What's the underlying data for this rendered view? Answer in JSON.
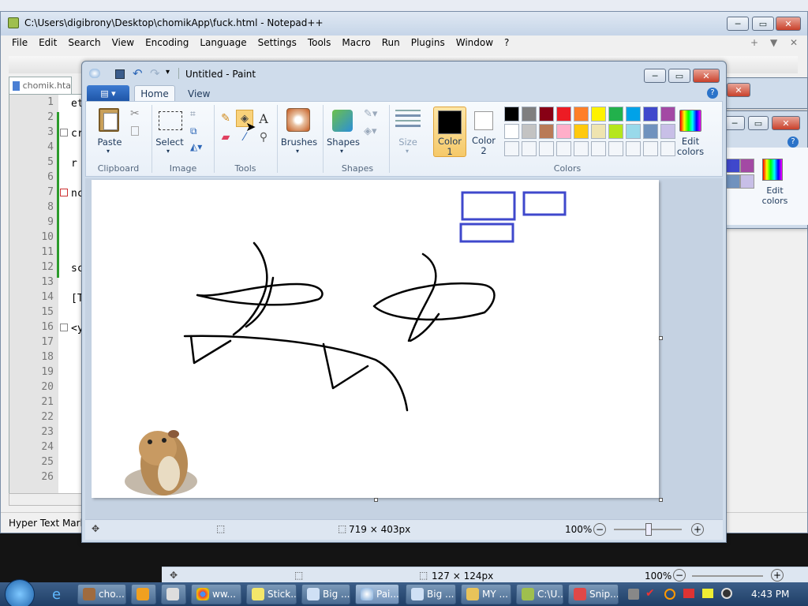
{
  "desktop": {
    "bg": "#101010"
  },
  "notepad": {
    "title": "C:\\Users\\digibrony\\Desktop\\chomikApp\\fuck.html - Notepad++",
    "menu": [
      "File",
      "Edit",
      "Search",
      "View",
      "Encoding",
      "Language",
      "Settings",
      "Tools",
      "Macro",
      "Run",
      "Plugins",
      "Window",
      "?"
    ],
    "tab_label": "chomik.hta",
    "line_numbers": [
      "1",
      "2",
      "3",
      "4",
      "5",
      "6",
      "7",
      "8",
      "9",
      "10",
      "11",
      "12",
      "13",
      "14",
      "15",
      "16",
      "17",
      "18",
      "19",
      "20",
      "21",
      "22",
      "23",
      "24",
      "25",
      "26"
    ],
    "code_fragments": [
      "et",
      "cr",
      "r",
      "nc",
      "sc",
      "[T",
      "<y"
    ],
    "status_left": "Hyper Text Marku",
    "menu_extra": [
      "+",
      "▼",
      "✕"
    ]
  },
  "back_paint": {
    "edit_colors": "Edit colors",
    "status_size": "127 × 124px",
    "zoom": "100%"
  },
  "paint": {
    "title": "Untitled - Paint",
    "tabs": {
      "home": "Home",
      "view": "View"
    },
    "groups": {
      "clipboard": "Clipboard",
      "image": "Image",
      "tools": "Tools",
      "shapes": "Shapes",
      "colors": "Colors"
    },
    "buttons": {
      "paste": "Paste",
      "select": "Select",
      "brushes": "Brushes",
      "shapes": "Shapes",
      "size": "Size",
      "color1": "Color",
      "color1_num": "1",
      "color2": "Color",
      "color2_num": "2",
      "edit_colors": "Edit colors"
    },
    "palette_row1": [
      "#000000",
      "#7f7f7f",
      "#880015",
      "#ed1c24",
      "#ff7f27",
      "#fff200",
      "#22b14c",
      "#00a2e8",
      "#3f48cc",
      "#a349a4"
    ],
    "palette_row2": [
      "#ffffff",
      "#c3c3c3",
      "#b97a57",
      "#ffaec9",
      "#ffc90e",
      "#efe4b0",
      "#b5e61d",
      "#99d9ea",
      "#7092be",
      "#c8bfe7"
    ],
    "color1_value": "#000000",
    "color2_value": "#ffffff",
    "canvas_size": "719 × 403px",
    "zoom": "100%"
  },
  "taskbar": {
    "items": [
      "cho...",
      "",
      "",
      "ww...",
      "Stick...",
      "Big ...",
      "Pai...",
      "Big ...",
      "MY ...",
      "C:\\U...",
      "Snip..."
    ],
    "time": "4:43 PM"
  }
}
